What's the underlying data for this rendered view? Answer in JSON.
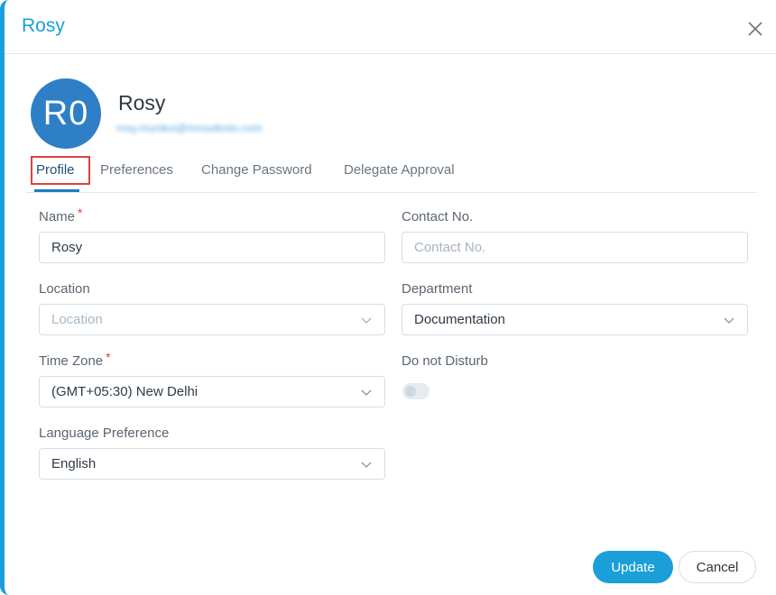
{
  "modal": {
    "title": "Rosy"
  },
  "user": {
    "initials": "R0",
    "name": "Rosy",
    "email": "rosy.munikoi@mroudesto.com"
  },
  "tabs": [
    {
      "label": "Profile",
      "active": true
    },
    {
      "label": "Preferences",
      "active": false
    },
    {
      "label": "Change Password",
      "active": false
    },
    {
      "label": "Delegate Approval",
      "active": false
    }
  ],
  "form": {
    "name": {
      "label": "Name",
      "required": "*",
      "value": "Rosy"
    },
    "contact": {
      "label": "Contact No.",
      "placeholder": "Contact No."
    },
    "location": {
      "label": "Location",
      "placeholder": "Location"
    },
    "department": {
      "label": "Department",
      "value": "Documentation"
    },
    "timezone": {
      "label": "Time Zone",
      "required": "*",
      "value": "(GMT+05:30) New Delhi"
    },
    "dnd": {
      "label": "Do not Disturb",
      "enabled": false
    },
    "language": {
      "label": "Language Preference",
      "value": "English"
    }
  },
  "buttons": {
    "update": "Update",
    "cancel": "Cancel"
  },
  "colors": {
    "accent": "#1a9fd9",
    "avatar": "#2f7fc6",
    "required": "#e0403f"
  },
  "icons": {
    "close": "close-icon",
    "dropdown": "chevron-down-icon"
  }
}
